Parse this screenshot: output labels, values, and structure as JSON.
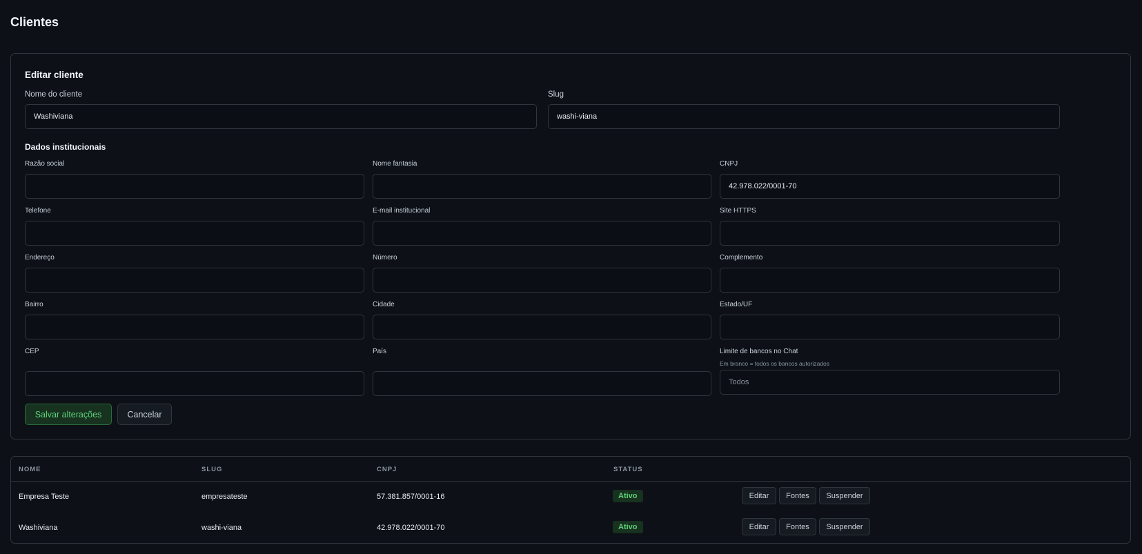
{
  "page": {
    "title": "Clientes"
  },
  "edit_form": {
    "title": "Editar cliente",
    "name_label": "Nome do cliente",
    "name_value": "Washiviana",
    "slug_label": "Slug",
    "slug_value": "washi-viana",
    "institutional_title": "Dados institucionais",
    "fields": {
      "razao_social": {
        "label": "Razão social",
        "value": ""
      },
      "nome_fantasia": {
        "label": "Nome fantasia",
        "value": ""
      },
      "cnpj": {
        "label": "CNPJ",
        "value": "42.978.022/0001-70"
      },
      "telefone": {
        "label": "Telefone",
        "value": ""
      },
      "email": {
        "label": "E-mail institucional",
        "value": ""
      },
      "site": {
        "label": "Site HTTPS",
        "value": ""
      },
      "endereco": {
        "label": "Endereço",
        "value": ""
      },
      "numero": {
        "label": "Número",
        "value": ""
      },
      "complemento": {
        "label": "Complemento",
        "value": ""
      },
      "bairro": {
        "label": "Bairro",
        "value": ""
      },
      "cidade": {
        "label": "Cidade",
        "value": ""
      },
      "estado": {
        "label": "Estado/UF",
        "value": ""
      },
      "cep": {
        "label": "CEP",
        "value": ""
      },
      "pais": {
        "label": "País",
        "value": ""
      },
      "limite": {
        "label": "Limite de bancos no Chat",
        "hint": "Em branco = todos os bancos autorizados",
        "placeholder": "Todos",
        "value": ""
      }
    },
    "save_label": "Salvar alterações",
    "cancel_label": "Cancelar"
  },
  "table": {
    "headers": {
      "nome": "NOME",
      "slug": "SLUG",
      "cnpj": "CNPJ",
      "status": "STATUS"
    },
    "rows": [
      {
        "nome": "Empresa Teste",
        "slug": "empresateste",
        "cnpj": "57.381.857/0001-16",
        "status": "Ativo"
      },
      {
        "nome": "Washiviana",
        "slug": "washi-viana",
        "cnpj": "42.978.022/0001-70",
        "status": "Ativo"
      }
    ],
    "actions": {
      "edit": "Editar",
      "sources": "Fontes",
      "suspend": "Suspender"
    }
  },
  "colors": {
    "background": "#0d1117",
    "border": "#30363d",
    "success_bg": "#17321f",
    "success_text": "#5fd17a"
  }
}
